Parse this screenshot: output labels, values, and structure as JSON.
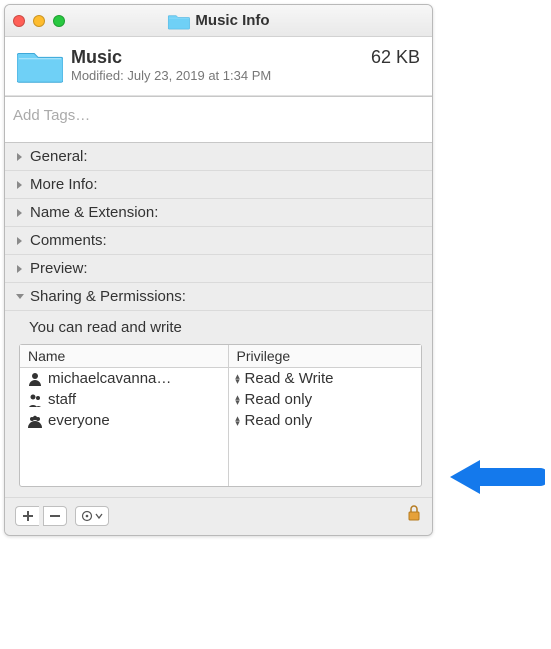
{
  "window": {
    "title": "Music Info"
  },
  "header": {
    "name": "Music",
    "modified_label": "Modified:",
    "modified_value": "July 23, 2019 at 1:34 PM",
    "size": "62 KB"
  },
  "tags": {
    "placeholder": "Add Tags…"
  },
  "sections": {
    "general": "General:",
    "more_info": "More Info:",
    "name_ext": "Name & Extension:",
    "comments": "Comments:",
    "preview": "Preview:",
    "sharing": "Sharing & Permissions:"
  },
  "permissions": {
    "note": "You can read and write",
    "col_name": "Name",
    "col_priv": "Privilege",
    "rows": [
      {
        "user": "michaelcavanna…",
        "priv": "Read & Write",
        "icon": "single"
      },
      {
        "user": "staff",
        "priv": "Read only",
        "icon": "pair"
      },
      {
        "user": "everyone",
        "priv": "Read only",
        "icon": "group"
      }
    ]
  },
  "toolbar": {
    "add": "+",
    "remove": "−",
    "action": "⊙"
  }
}
